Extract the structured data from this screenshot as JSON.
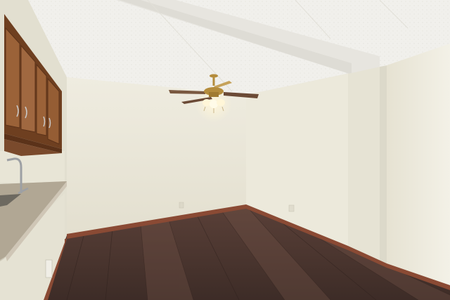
{
  "photo": {
    "subject": "empty-room-interior",
    "colors": {
      "ceiling": "#f1f0ec",
      "ceiling_shadow": "#e4e2dc",
      "wall_back": "#ebe8d9",
      "wall_left": "#e2dfd0",
      "wall_right": "#f0eee2",
      "wall_column": "#e6e3d4",
      "baseboard": "#8a4a34",
      "floor_dark": "#3d2c27",
      "floor_mid": "#5a4038",
      "floor_light": "#735448",
      "cabinet": "#9b6238",
      "cabinet_dark": "#6e3f20",
      "countertop": "#b8ad9c",
      "faucet": "#9da0a4",
      "fan_brass": "#b48c3c",
      "fan_blade": "#6b4a36",
      "light_glow": "#fff6d8"
    }
  }
}
